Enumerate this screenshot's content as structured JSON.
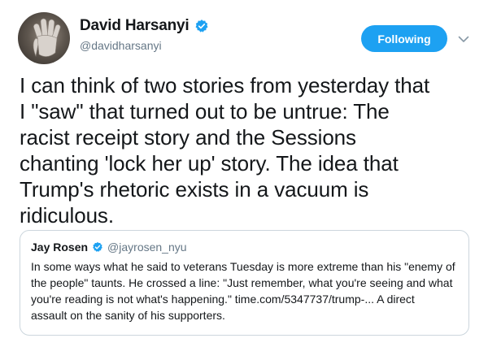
{
  "author": {
    "display_name": "David Harsanyi",
    "handle": "@davidharsanyi",
    "verified_icon": "verified-badge",
    "avatar": "profile-photo"
  },
  "follow_button": {
    "label": "Following"
  },
  "caret": {
    "icon": "chevron-down-icon"
  },
  "tweet": {
    "text": "I can think of two stories from yesterday that\nI \"saw\" that turned out to be untrue: The\nracist receipt story and the Sessions\nchanting 'lock her up' story. The idea that\nTrump's rhetoric exists in a vacuum is\nridiculous."
  },
  "quoted_tweet": {
    "display_name": "Jay Rosen",
    "handle": "@jayrosen_nyu",
    "text": "In some ways what he said to veterans Tuesday is more extreme than his \"enemy of\nthe people\" taunts. He crossed a line: \"Just remember, what you're seeing and what\nyou're reading is not what's happening.\" time.com/5347737/trump-... A direct\nassault on the sanity of his supporters."
  },
  "colors": {
    "accent": "#1da1f2",
    "text": "#14171a",
    "secondary_text": "#657786",
    "border": "#ccd6dd"
  }
}
